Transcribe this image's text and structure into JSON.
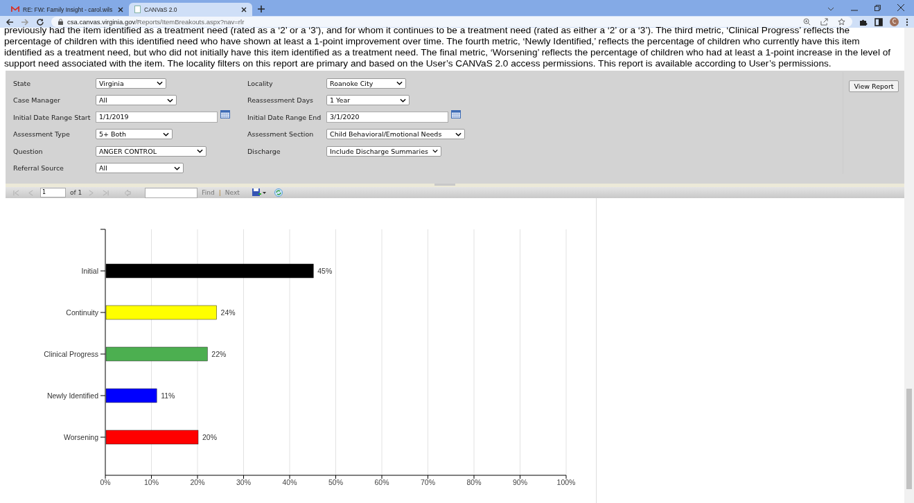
{
  "browser": {
    "tabs": [
      {
        "title": "RE: FW: Family Insight - carol.wils",
        "selected": false,
        "kind": "mail"
      },
      {
        "title": "CANVaS 2.0",
        "selected": true,
        "kind": "page"
      }
    ],
    "address": {
      "host": "csa.canvas.virginia.gov",
      "path": "/Reports/ItemBreakouts.aspx?nav=rlr"
    },
    "profile_initial": "C"
  },
  "description": [
    "previously had the item identified as a treatment need (rated as a ‘2’ or a ‘3’), and for whom it continues to be a treatment need (rated as either a ‘2’ or a ‘3’). The third metric, ‘Clinical Progress’ reflects the",
    "percentage of children with this identified need who have shown at least a 1-point improvement over time. The fourth metric, ‘Newly Identified,’ reflects the percentage of children who currently have this item",
    "identified as a treatment need, but who did not initially have this item identified as a treatment need. The final metric, ‘Worsening’ reflects the percentage of children who had at least a 1-point increase in the level of",
    "support need associated with the item. The locality filters on this report are primary and based on the User’s CANVaS 2.0 access permissions. This report is available according to User’s permissions."
  ],
  "filters": [
    [
      {
        "label": "State",
        "kind": "select",
        "value": "Virginia"
      },
      {
        "label": "Locality",
        "kind": "select",
        "value": "Roanoke City"
      }
    ],
    [
      {
        "label": "Case Manager",
        "kind": "select",
        "value": "All"
      },
      {
        "label": "Reassessment Days",
        "kind": "select",
        "value": "1 Year"
      }
    ],
    [
      {
        "label": "Initial Date Range Start",
        "kind": "date",
        "value": "1/1/2019"
      },
      {
        "label": "Initial Date Range End",
        "kind": "date",
        "value": "3/1/2020"
      }
    ],
    [
      {
        "label": "Assessment Type",
        "kind": "select",
        "value": "5+ Both"
      },
      {
        "label": "Assessment Section",
        "kind": "select",
        "value": "Child Behavioral/Emotional Needs"
      }
    ],
    [
      {
        "label": "Question",
        "kind": "select",
        "value": "ANGER CONTROL"
      },
      {
        "label": "Discharge",
        "kind": "select",
        "value": "Include Discharge Summaries"
      }
    ],
    [
      {
        "label": "Referral Source",
        "kind": "select",
        "value": "All"
      }
    ]
  ],
  "view_button": "View Report",
  "toolbar": {
    "page": "1",
    "of_label": "of 1",
    "find": "Find",
    "separator": "|",
    "next": "Next"
  },
  "chart_data": {
    "type": "bar",
    "orientation": "horizontal",
    "categories": [
      "Initial",
      "Continuity",
      "Clinical Progress",
      "Newly Identified",
      "Worsening"
    ],
    "values": [
      45,
      24,
      22,
      11,
      20
    ],
    "grid": true,
    "colors": [
      "#000000",
      "#ffff00",
      "#4caf50",
      "#0000ff",
      "#ff0000"
    ],
    "xlim": [
      0,
      100
    ],
    "xticks": [
      {
        "value": 0,
        "label": "0%"
      },
      {
        "value": 10,
        "label": "10%"
      },
      {
        "value": 20,
        "label": "20%"
      },
      {
        "value": 30,
        "label": "30%"
      },
      {
        "value": 40,
        "label": "40%"
      },
      {
        "value": 50,
        "label": "50%"
      },
      {
        "value": 60,
        "label": "60%"
      },
      {
        "value": 70,
        "label": "70%"
      },
      {
        "value": 80,
        "label": "80%"
      },
      {
        "value": 90,
        "label": "90%"
      },
      {
        "value": 100,
        "label": "100%"
      }
    ],
    "value_labels": [
      "45%",
      "24%",
      "22%",
      "11%",
      "20%"
    ]
  }
}
